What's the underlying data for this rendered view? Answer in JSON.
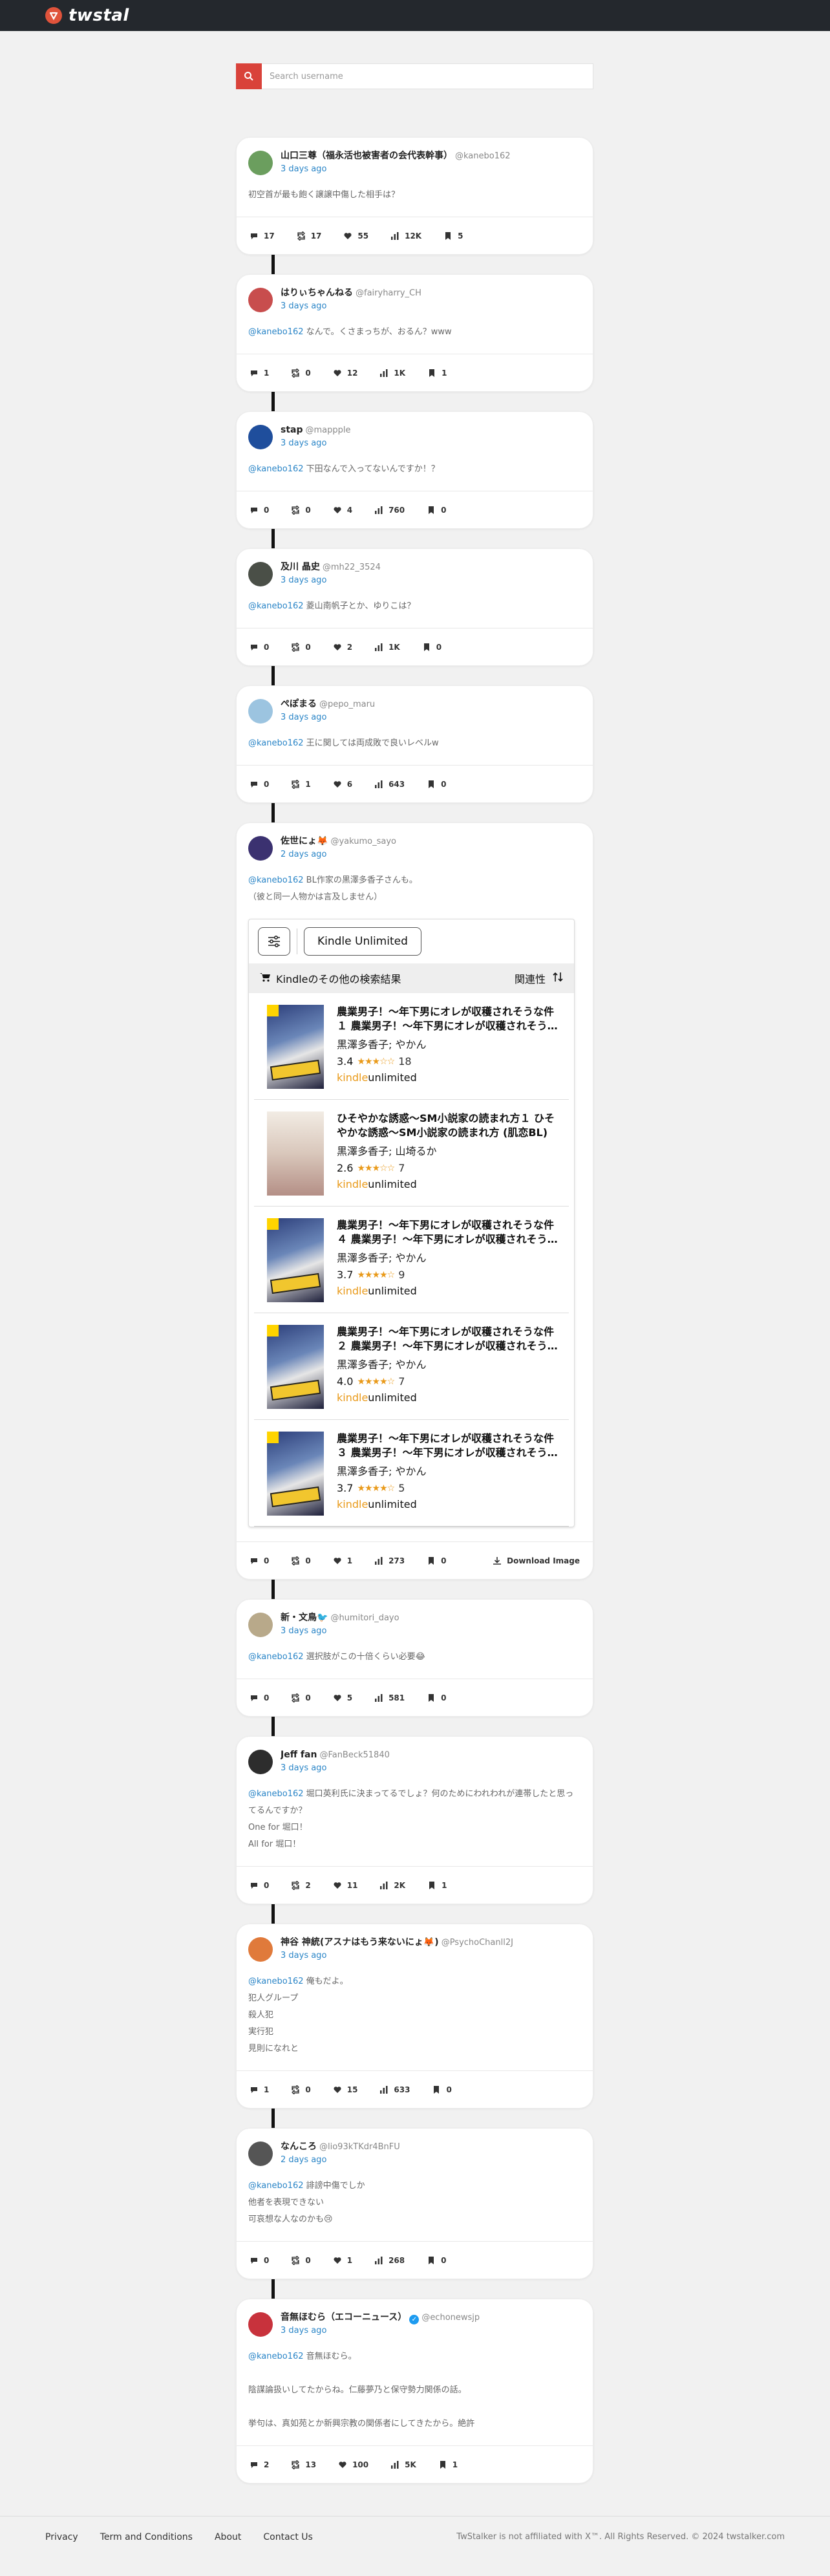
{
  "brand": {
    "name": "twstal",
    "accent": "#e0533b"
  },
  "search": {
    "placeholder": "Search username"
  },
  "stat_icons": [
    "reply-icon",
    "retweet-icon",
    "heart-icon",
    "views-icon",
    "bookmark-icon"
  ],
  "download_label": "Download Image",
  "posts": [
    {
      "name": "山口三尊（福永活也被害者の会代表幹事）",
      "handle": "@kanebo162",
      "time": "3 days ago",
      "avatar_color": "#6b9e5e",
      "verified": false,
      "mention": "",
      "lines": [
        "初空首が最も飽く譲譲中傷した相手は？"
      ],
      "stats": {
        "reply": "17",
        "rt": "17",
        "like": "55",
        "views": "12K",
        "bm": "5"
      }
    },
    {
      "name": "はりぃちゃんねる",
      "handle": "@fairyharry_CH",
      "time": "3 days ago",
      "avatar_color": "#c84d4d",
      "verified": false,
      "mention": "@kanebo162",
      "lines": [
        "なんで。くさまっちが、おるん？www"
      ],
      "stats": {
        "reply": "1",
        "rt": "0",
        "like": "12",
        "views": "1K",
        "bm": "1"
      }
    },
    {
      "name": "stap",
      "handle": "@mappple",
      "time": "3 days ago",
      "avatar_color": "#1f4e9c",
      "verified": false,
      "mention": "@kanebo162",
      "lines": [
        "下田なんで入ってないんですか！？"
      ],
      "stats": {
        "reply": "0",
        "rt": "0",
        "like": "4",
        "views": "760",
        "bm": "0"
      }
    },
    {
      "name": "及川 晶史",
      "handle": "@mh22_3524",
      "time": "3 days ago",
      "avatar_color": "#4a4f47",
      "verified": false,
      "mention": "@kanebo162",
      "lines": [
        "菱山南帆子とか、ゆりこは？"
      ],
      "stats": {
        "reply": "0",
        "rt": "0",
        "like": "2",
        "views": "1K",
        "bm": "0"
      }
    },
    {
      "name": "ぺぽまる",
      "handle": "@pepo_maru",
      "time": "3 days ago",
      "avatar_color": "#9cc4e0",
      "verified": false,
      "mention": "@kanebo162",
      "lines": [
        "王に関しては両成敗で良いレベルw"
      ],
      "stats": {
        "reply": "0",
        "rt": "1",
        "like": "6",
        "views": "643",
        "bm": "0"
      }
    },
    {
      "name": "佐世にょ🦊",
      "handle": "@yakumo_sayo",
      "time": "2 days ago",
      "avatar_color": "#3b3170",
      "verified": false,
      "mention": "@kanebo162",
      "lines": [
        "BL作家の黒澤多香子さんも。",
        "（彼と同一人物かは言及しません）"
      ],
      "stats": {
        "reply": "0",
        "rt": "0",
        "like": "1",
        "views": "273",
        "bm": "0"
      },
      "download": true
    },
    {
      "name": "新・文鳥🐦",
      "handle": "@humitori_dayo",
      "time": "3 days ago",
      "avatar_color": "#b8a98a",
      "verified": false,
      "mention": "@kanebo162",
      "lines": [
        "選択肢がこの十倍くらい必要😂"
      ],
      "stats": {
        "reply": "0",
        "rt": "0",
        "like": "5",
        "views": "581",
        "bm": "0"
      }
    },
    {
      "name": "Jeff fan",
      "handle": "@FanBeck51840",
      "time": "3 days ago",
      "avatar_color": "#2d2d2d",
      "verified": false,
      "mention": "@kanebo162",
      "lines": [
        "堀口英利氏に決まってるでしょ？何のためにわれわれが連帯したと思ってるんですか？",
        "One for 堀口！",
        "All for 堀口！"
      ],
      "stats": {
        "reply": "0",
        "rt": "2",
        "like": "11",
        "views": "2K",
        "bm": "1"
      }
    },
    {
      "name": "神谷 神統(アスナはもう来ないにょ🦊)",
      "handle": "@PsychoChanll2J",
      "time": "3 days ago",
      "avatar_color": "#e07a3b",
      "verified": false,
      "mention": "@kanebo162",
      "lines": [
        "俺もだよ。",
        "犯人グループ",
        "殺人犯",
        "実行犯",
        "見則になれと"
      ],
      "stats": {
        "reply": "1",
        "rt": "0",
        "like": "15",
        "views": "633",
        "bm": "0"
      }
    },
    {
      "name": "なんころ",
      "handle": "@lio93kTKdr4BnFU",
      "time": "2 days ago",
      "avatar_color": "#555555",
      "verified": false,
      "mention": "@kanebo162",
      "lines": [
        "誹謗中傷でしか",
        "他者を表現できない",
        "可哀想な人なのかも😢"
      ],
      "stats": {
        "reply": "0",
        "rt": "0",
        "like": "1",
        "views": "268",
        "bm": "0"
      }
    },
    {
      "name": "音無ほむら（エコーニュース）",
      "handle": "@echonewsjp",
      "time": "3 days ago",
      "avatar_color": "#c8323c",
      "verified": true,
      "mention": "@kanebo162",
      "lines": [
        "音無ほむら。",
        "",
        "陰謀論扱いしてたからね。仁藤夢乃と保守勢力関係の話。",
        "",
        "挙句は、真如苑とか新興宗教の関係者にしてきたから。絶許"
      ],
      "stats": {
        "reply": "2",
        "rt": "13",
        "like": "100",
        "views": "5K",
        "bm": "1"
      }
    }
  ],
  "kindle": {
    "ku_button": "Kindle Unlimited",
    "section_title": "Kindleのその他の検索結果",
    "sort_label": "関連性",
    "ku_k": "kindle",
    "ku_u": "unlimited",
    "books": [
      {
        "title": "農業男子！～年下男にオレが収穫されそうな件１ 農業男子！～年下男にオレが収穫されそうな件",
        "author": "黒澤多香子; やかん",
        "rating": "3.4",
        "stars": "★★★☆☆",
        "count": "18",
        "alt": false
      },
      {
        "title": "ひそやかな誘惑～SM小説家の読まれ方１ ひそやかな誘惑～SM小説家の読まれ方 (肌恋BL)",
        "author": "黒澤多香子; 山埼るか",
        "rating": "2.6",
        "stars": "★★★☆☆",
        "count": "7",
        "alt": true
      },
      {
        "title": "農業男子！～年下男にオレが収穫されそうな件４ 農業男子！～年下男にオレが収穫されそうな件",
        "author": "黒澤多香子; やかん",
        "rating": "3.7",
        "stars": "★★★★☆",
        "count": "9",
        "alt": false
      },
      {
        "title": "農業男子！～年下男にオレが収穫されそうな件２ 農業男子！～年下男にオレが収穫されそうな件",
        "author": "黒澤多香子; やかん",
        "rating": "4.0",
        "stars": "★★★★☆",
        "count": "7",
        "alt": false
      },
      {
        "title": "農業男子！～年下男にオレが収穫されそうな件３ 農業男子！～年下男にオレが収穫されそうな件",
        "author": "黒澤多香子; やかん",
        "rating": "3.7",
        "stars": "★★★★☆",
        "count": "5",
        "alt": false
      }
    ]
  },
  "footer": {
    "links": [
      "Privacy",
      "Term and Conditions",
      "About",
      "Contact Us"
    ],
    "note": "TwStalker is not affiliated with X™. All Rights Reserved. © 2024 twstalker.com"
  }
}
